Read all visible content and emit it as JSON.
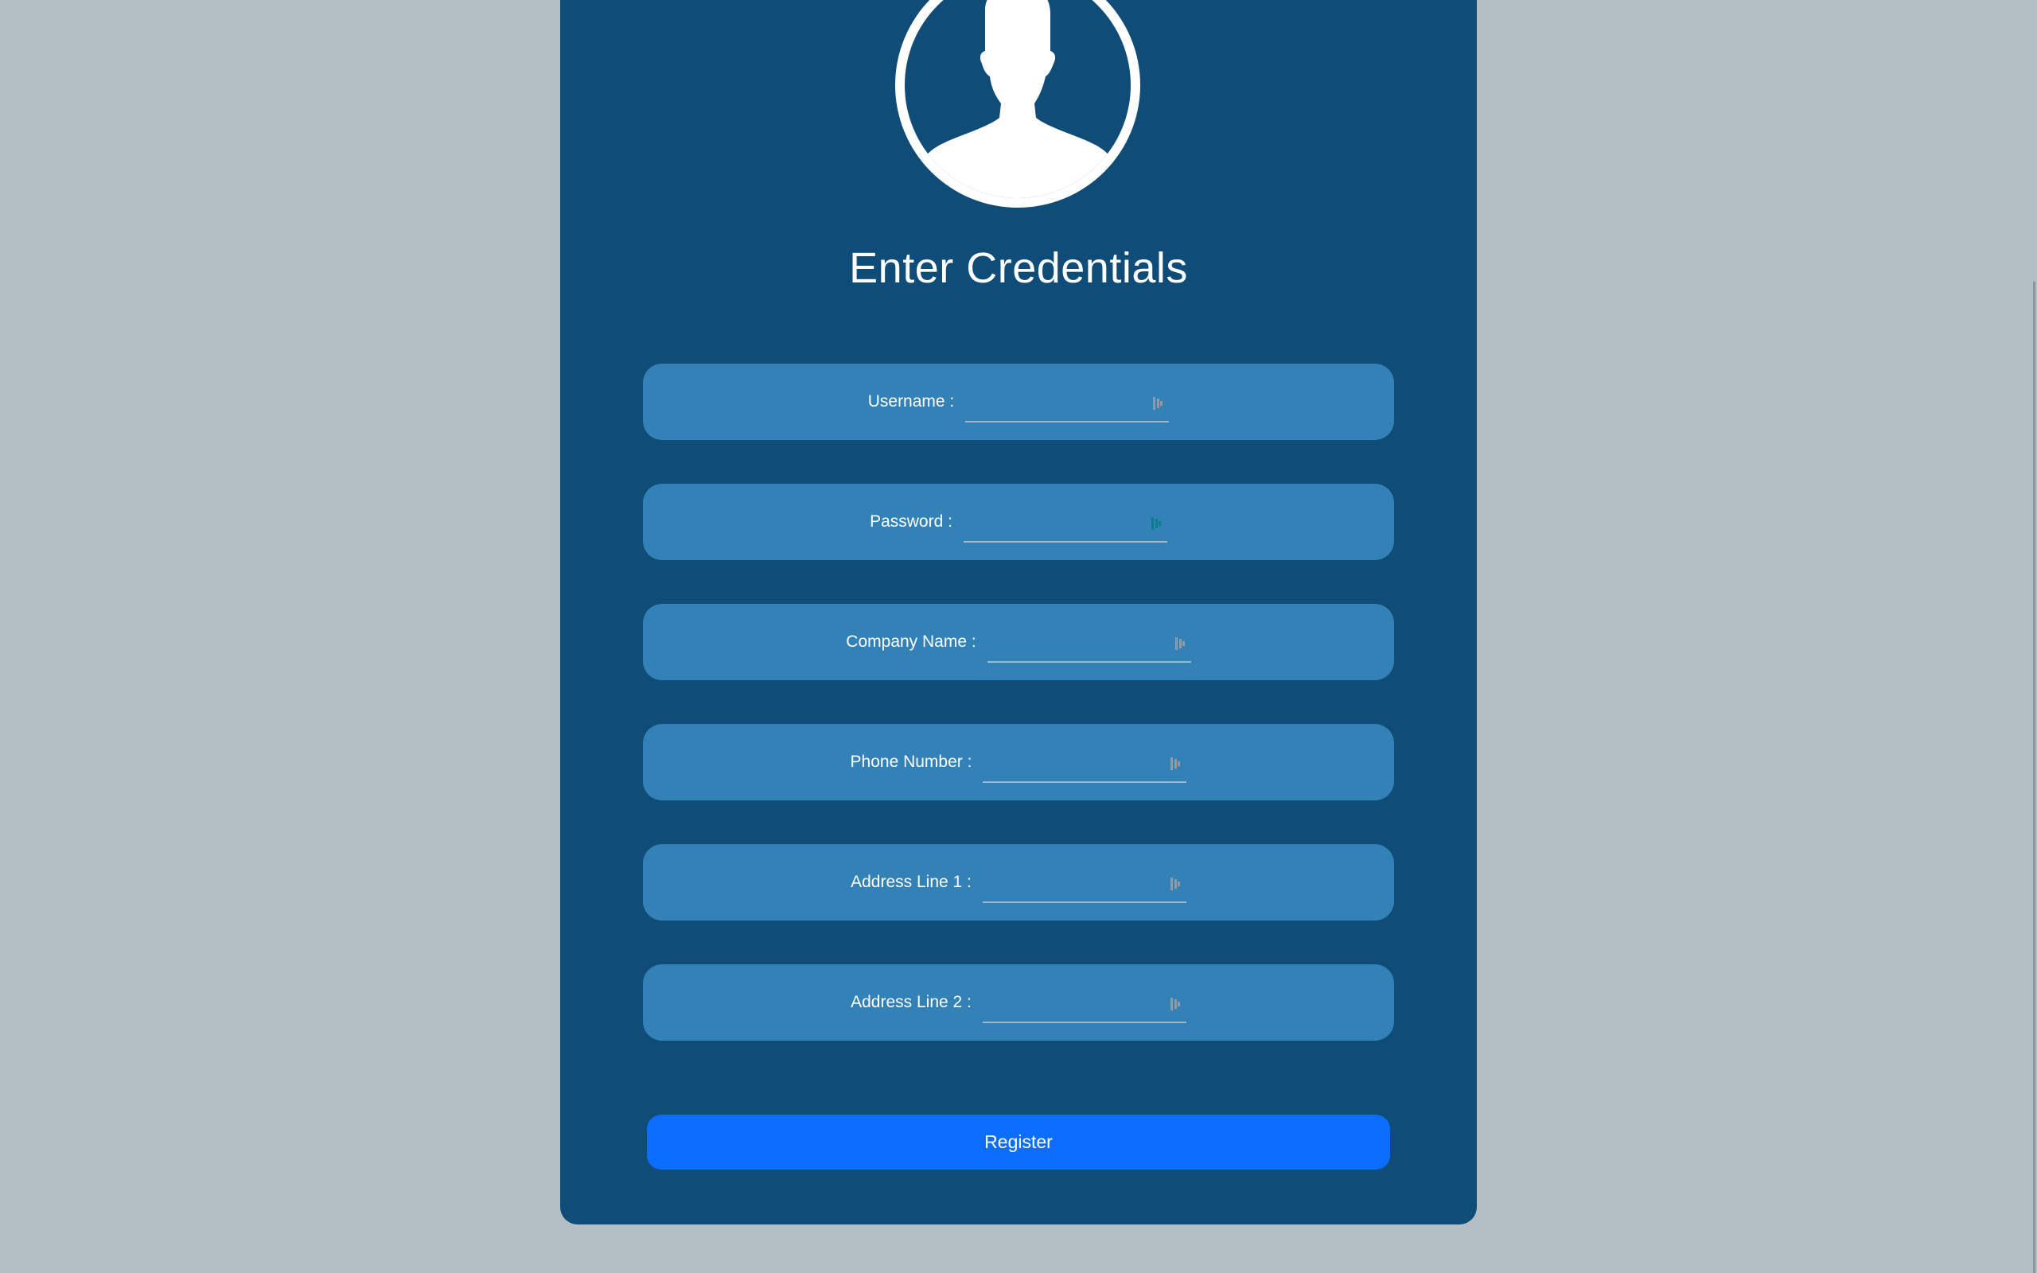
{
  "form": {
    "title": "Enter Credentials",
    "fields": [
      {
        "label": "Username :",
        "value": "",
        "type": "text",
        "icon": "key-icon"
      },
      {
        "label": "Password :",
        "value": "",
        "type": "password",
        "icon": "key-icon"
      },
      {
        "label": "Company Name :",
        "value": "",
        "type": "text",
        "icon": "key-icon"
      },
      {
        "label": "Phone Number :",
        "value": "",
        "type": "text",
        "icon": "key-icon"
      },
      {
        "label": "Address Line 1 :",
        "value": "",
        "type": "text",
        "icon": "key-icon"
      },
      {
        "label": "Address Line 2 :",
        "value": "",
        "type": "text",
        "icon": "key-icon"
      }
    ],
    "submit_label": "Register"
  },
  "avatar": {
    "icon": "user-silhouette-icon"
  },
  "colors": {
    "background": "#b3bec5",
    "card": "#0f4c77",
    "field_row": "#3282b8",
    "button": "#0d6efd",
    "text": "#ffffff"
  }
}
